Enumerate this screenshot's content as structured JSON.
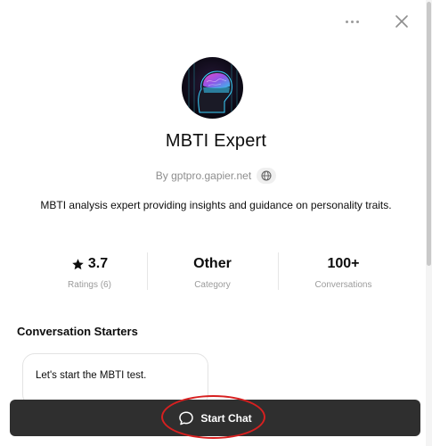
{
  "gpt": {
    "name": "MBTI Expert",
    "by_text": "By gptpro.gapier.net",
    "description": "MBTI analysis expert providing insights and guidance on personality traits."
  },
  "stats": [
    {
      "value": "3.7",
      "label": "Ratings (6)",
      "icon": "star-icon"
    },
    {
      "value": "Other",
      "label": "Category"
    },
    {
      "value": "100+",
      "label": "Conversations"
    }
  ],
  "starters": {
    "heading": "Conversation Starters",
    "items": [
      "Let's start the MBTI test."
    ]
  },
  "actions": {
    "start_chat_label": "Start Chat"
  },
  "icons": {
    "more": "more-options-icon",
    "close": "close-icon",
    "globe": "globe-icon",
    "chat": "chat-bubble-icon"
  },
  "colors": {
    "button_bg": "#2f2f2f",
    "highlight": "#d72020",
    "muted_text": "#8e8e8e"
  }
}
